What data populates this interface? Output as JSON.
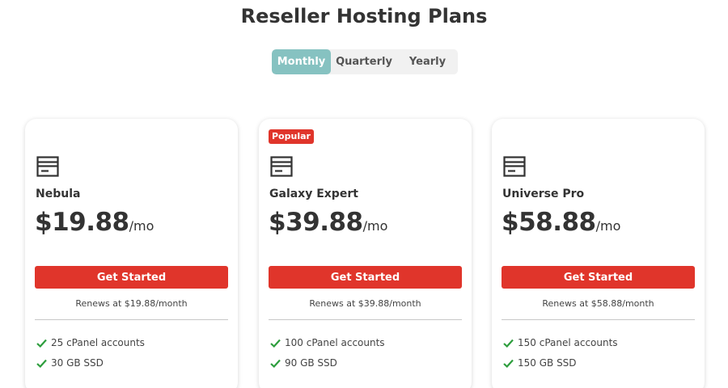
{
  "page": {
    "title": "Reseller Hosting Plans"
  },
  "billing_toggle": {
    "options": [
      {
        "label": "Monthly",
        "active": true
      },
      {
        "label": "Quarterly",
        "active": false
      },
      {
        "label": "Yearly",
        "active": false
      }
    ]
  },
  "colors": {
    "accent_red": "#e0352b",
    "toggle_active": "#86c2c1",
    "check_green": "#2e9e3e"
  },
  "plans": [
    {
      "name": "Nebula",
      "badge": "",
      "price": "$19.88",
      "per": "/mo",
      "cta": "Get Started",
      "renewal": "Renews at $19.88/month",
      "features": [
        "25 cPanel accounts",
        "30 GB SSD"
      ],
      "icon": "server-icon"
    },
    {
      "name": "Galaxy Expert",
      "badge": "Popular",
      "price": "$39.88",
      "per": "/mo",
      "cta": "Get Started",
      "renewal": "Renews at $39.88/month",
      "features": [
        "100 cPanel accounts",
        "90 GB SSD"
      ],
      "icon": "server-icon"
    },
    {
      "name": "Universe Pro",
      "badge": "",
      "price": "$58.88",
      "per": "/mo",
      "cta": "Get Started",
      "renewal": "Renews at $58.88/month",
      "features": [
        "150 cPanel accounts",
        "150 GB SSD"
      ],
      "icon": "server-icon"
    }
  ]
}
